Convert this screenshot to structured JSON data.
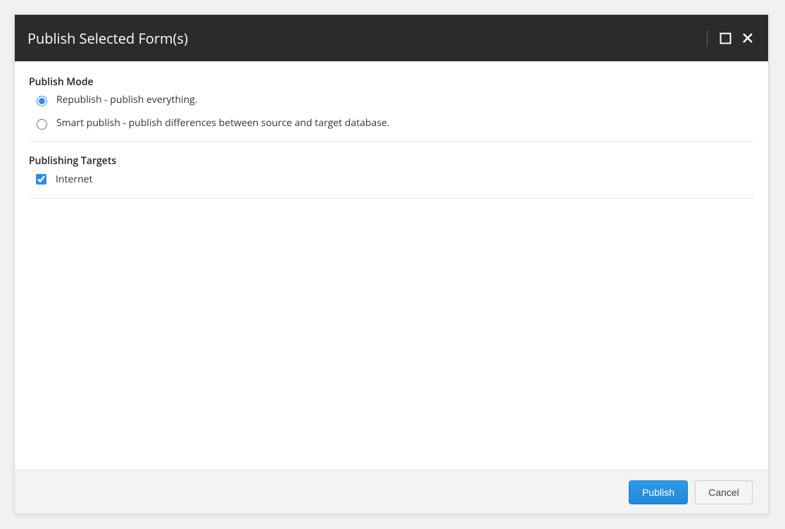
{
  "dialog": {
    "title": "Publish Selected Form(s)"
  },
  "publish_mode": {
    "label": "Publish Mode",
    "options": {
      "republish": "Republish - publish everything.",
      "smart": "Smart publish - publish differences between source and target database."
    },
    "selected": "republish"
  },
  "publishing_targets": {
    "label": "Publishing Targets",
    "items": {
      "internet": {
        "label": "Internet",
        "checked": true
      }
    }
  },
  "footer": {
    "publish_label": "Publish",
    "cancel_label": "Cancel"
  }
}
